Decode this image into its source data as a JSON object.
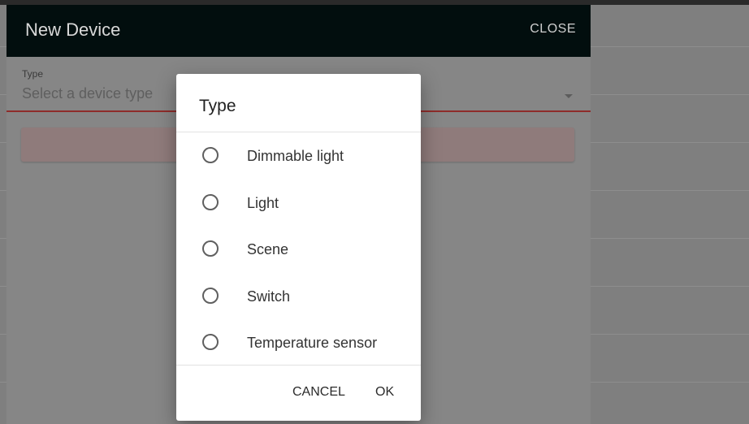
{
  "panel": {
    "title": "New Device",
    "close_label": "CLOSE"
  },
  "type_field": {
    "label": "Type",
    "placeholder": "Select a device type"
  },
  "dialog": {
    "title": "Type",
    "options": [
      {
        "label": "Dimmable light",
        "selected": false
      },
      {
        "label": "Light",
        "selected": false
      },
      {
        "label": "Scene",
        "selected": false
      },
      {
        "label": "Switch",
        "selected": false
      },
      {
        "label": "Temperature sensor",
        "selected": false
      }
    ],
    "cancel_label": "CANCEL",
    "ok_label": "OK"
  },
  "colors": {
    "header_bg": "#020e0e",
    "field_underline": "#8e2c2a",
    "error_bar": "#8f7b7b",
    "dialog_bg": "#ffffff"
  },
  "icons": {
    "dropdown": "arrow-drop-down-icon",
    "radio": "radio-unchecked-icon"
  }
}
